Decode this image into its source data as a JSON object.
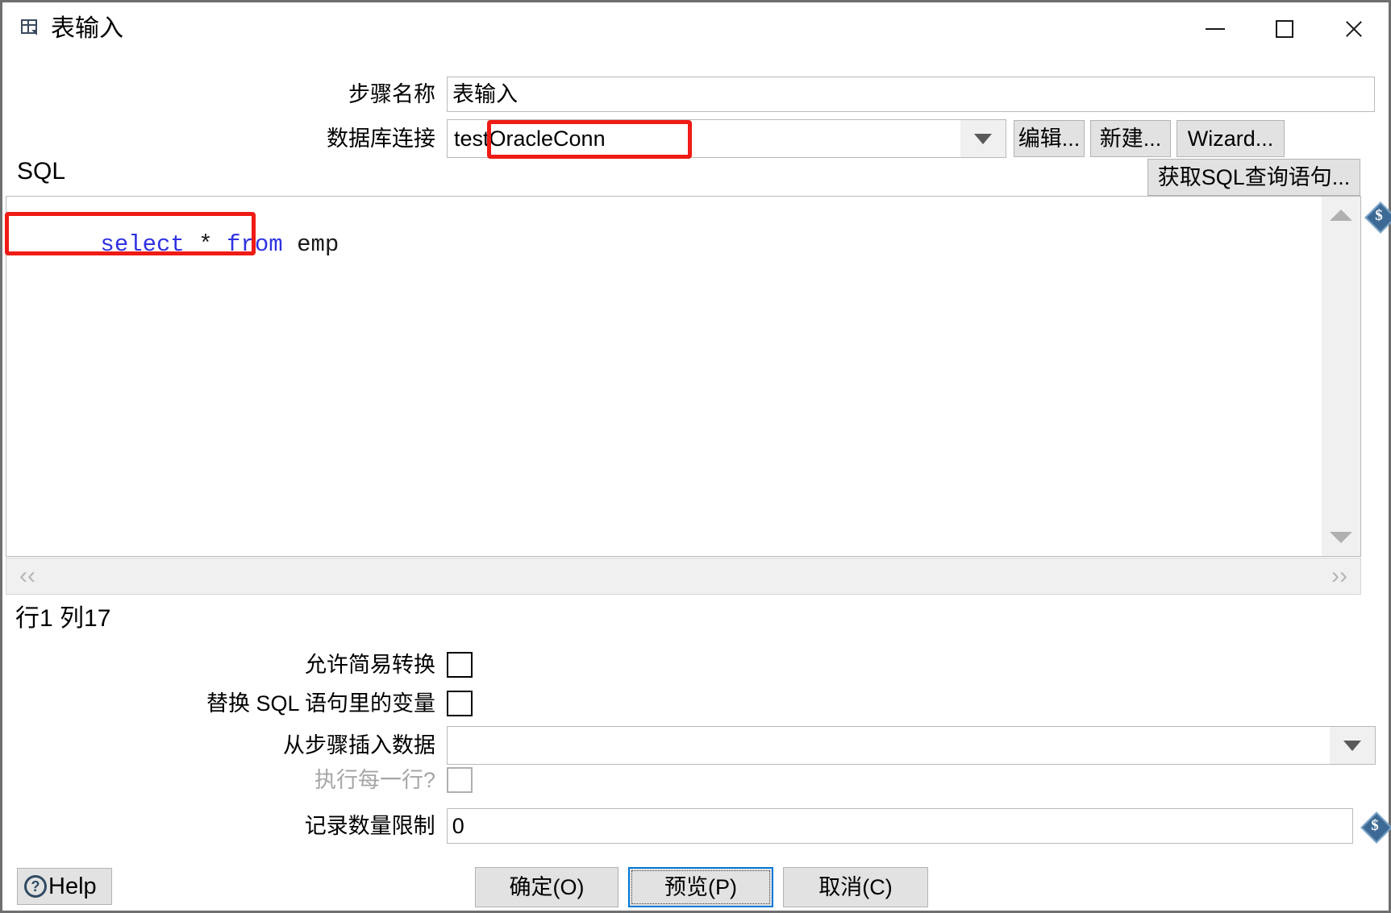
{
  "window": {
    "title": "表输入",
    "icon": "table-input-icon",
    "controls": {
      "minimize": "minimize-icon",
      "maximize": "maximize-icon",
      "close": "close-icon"
    }
  },
  "form": {
    "step_name_label": "步骤名称",
    "step_name_value": "表输入",
    "db_connection_label": "数据库连接",
    "db_connection_value": "testOracleConn",
    "edit_button": "编辑...",
    "new_button": "新建...",
    "wizard_button": "Wizard..."
  },
  "sql_section": {
    "label": "SQL",
    "get_sql_button": "获取SQL查询语句...",
    "sql_tokens": [
      {
        "text": "select",
        "type": "keyword"
      },
      {
        "text": " * ",
        "type": "plain"
      },
      {
        "text": "from",
        "type": "keyword"
      },
      {
        "text": " emp",
        "type": "plain"
      }
    ],
    "sql_full_text": "select * from emp",
    "cursor_status": "行1 列17",
    "variable_icon": "dollar-diamond-icon"
  },
  "options": {
    "allow_lazy_conversion_label": "允许简易转换",
    "allow_lazy_conversion_checked": false,
    "replace_variables_label": "替换 SQL 语句里的变量",
    "replace_variables_checked": false,
    "insert_data_from_step_label": "从步骤插入数据",
    "insert_data_from_step_value": "",
    "execute_for_each_row_label": "执行每一行?",
    "execute_for_each_row_checked": false,
    "execute_for_each_row_disabled": true,
    "limit_size_label": "记录数量限制",
    "limit_size_value": "0",
    "limit_variable_icon": "dollar-diamond-icon"
  },
  "footer": {
    "help_label": "Help",
    "help_icon": "question-circle-icon",
    "ok_label": "确定(O)",
    "preview_label": "预览(P)",
    "cancel_label": "取消(C)"
  },
  "colors": {
    "annotation": "#EF1B15",
    "keyword": "#2F32E0",
    "focus": "#0078D7",
    "button_face": "#E2E2E2"
  }
}
